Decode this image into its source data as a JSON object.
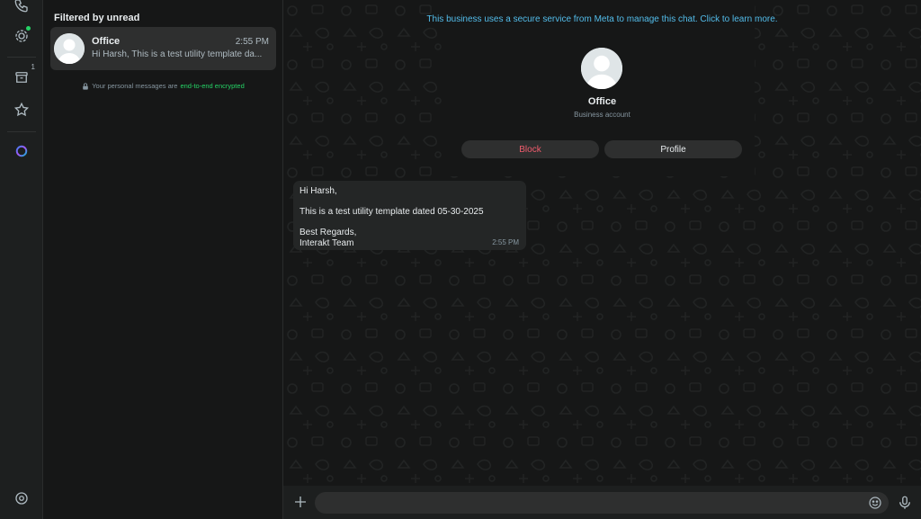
{
  "chat_list": {
    "filter_title": "Filtered by unread",
    "chats": [
      {
        "name": "Office",
        "time": "2:55 PM",
        "preview": "Hi Harsh, This is a test utility template da..."
      }
    ],
    "encryption_note": {
      "text": "Your personal messages are",
      "link": "end-to-end encrypted"
    }
  },
  "rail": {
    "archived_count": "1",
    "icons": [
      "phone-icon",
      "status-icon",
      "archive-icon",
      "star-icon",
      "meta-ai-icon",
      "settings-icon"
    ]
  },
  "conversation": {
    "banner": "This business uses a secure service from Meta to manage this chat. Click to learn more.",
    "contact_name": "Office",
    "contact_subtitle": "Business account",
    "block_label": "Block",
    "profile_label": "Profile",
    "message": {
      "lines": [
        "Hi Harsh,",
        "This is a test utility template dated 05-30-2025",
        "Best Regards,",
        "Interakt Team"
      ],
      "time": "2:55 PM"
    }
  },
  "composer": {
    "placeholder": ""
  },
  "colors": {
    "accent": "#25d366",
    "link": "#53bdeb",
    "danger": "#f15c6d",
    "background": "#161717",
    "panel": "#1d1f1f",
    "bubble": "#242626"
  }
}
